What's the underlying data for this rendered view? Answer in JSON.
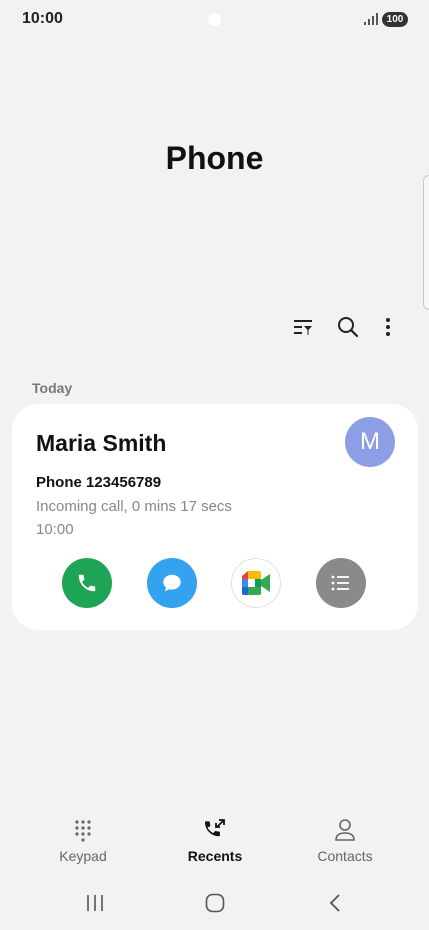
{
  "status_bar": {
    "time": "10:00",
    "battery": "100"
  },
  "header": {
    "title": "Phone"
  },
  "toolbar": {
    "filter_icon": "filter-icon",
    "search_icon": "search-icon",
    "more_icon": "more-vertical-icon"
  },
  "section": {
    "label": "Today"
  },
  "call_card": {
    "name": "Maria Smith",
    "avatar_initial": "M",
    "avatar_color": "#8c9fe6",
    "phone_line": "Phone 123456789",
    "detail": "Incoming call, 0 mins 17 secs",
    "time": "10:00",
    "actions": [
      {
        "icon": "phone-icon",
        "color": "#1fa356"
      },
      {
        "icon": "message-icon",
        "color": "#34a3ef"
      },
      {
        "icon": "video-meet-icon",
        "color": "#ffffff"
      },
      {
        "icon": "details-list-icon",
        "color": "#8a8a8a"
      }
    ]
  },
  "bottom_nav": {
    "items": [
      {
        "label": "Keypad",
        "icon": "keypad-icon",
        "active": false
      },
      {
        "label": "Recents",
        "icon": "recents-icon",
        "active": true
      },
      {
        "label": "Contacts",
        "icon": "contacts-icon",
        "active": false
      }
    ]
  },
  "system_nav": {
    "recent_apps_icon": "recent-apps-icon",
    "home_icon": "home-icon",
    "back_icon": "back-icon"
  }
}
